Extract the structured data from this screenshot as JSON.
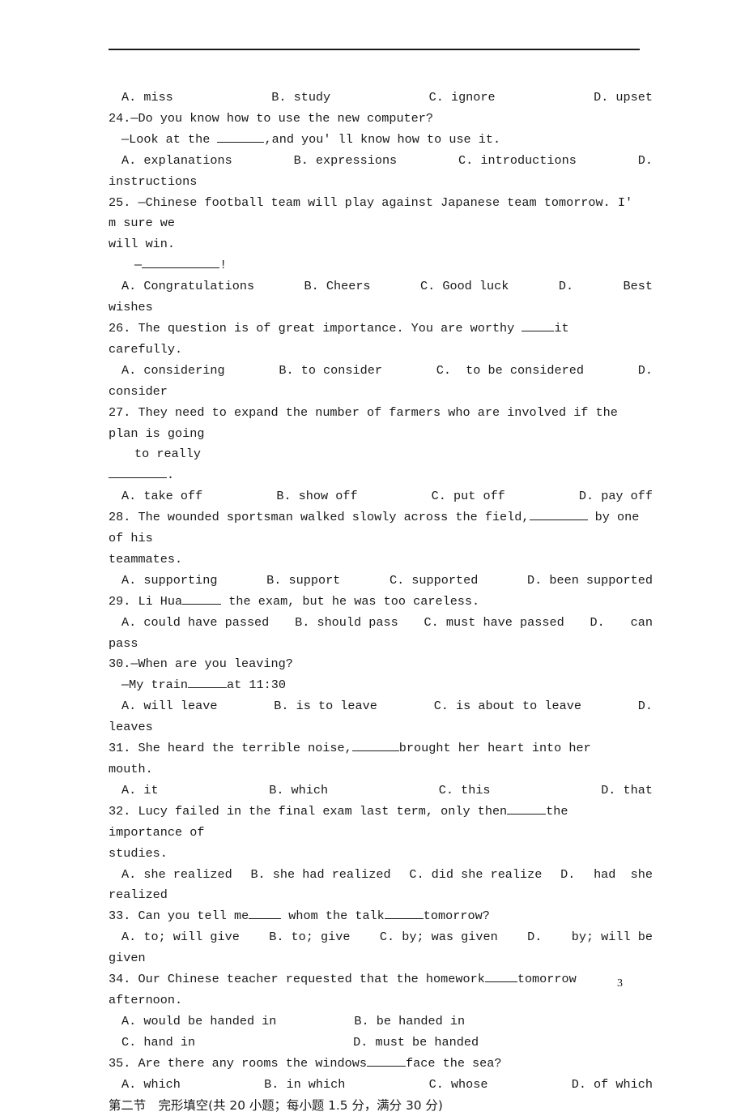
{
  "page": {
    "number": "3",
    "background": "#ffffff",
    "text_color": "#1a1a1a"
  },
  "header": {
    "rule": true
  },
  "lines": {
    "q23_options": {
      "a": "A. miss",
      "b": "B. study",
      "c": "C. ignore",
      "d": "D. upset"
    },
    "q24": {
      "number": "24.",
      "stem_q": "—Do you know how to use the new computer?",
      "stem_a_pre": "—Look at the ",
      "stem_a_post": ",and you' ll know how to use it.",
      "opt_a": "A. explanations",
      "opt_b": "B. expressions",
      "opt_c": "C. introductions",
      "opt_d": "D.",
      "opt_d_cont": "instructions"
    },
    "q25": {
      "number": "25.",
      "stem_line1": "—Chinese football team will play against Japanese team tomorrow. I' m sure we",
      "stem_line2": "will win.",
      "reply_pre": "—",
      "reply_post": "!",
      "opt_a": "A. Congratulations",
      "opt_b": "B. Cheers",
      "opt_c": "C. Good luck",
      "opt_d": "D.",
      "opt_d_tail": "Best",
      "opt_d_cont": "wishes"
    },
    "q26": {
      "number": "26.",
      "stem_pre": "The question is of great importance. You are worthy ",
      "stem_post": "it carefully.",
      "opt_a": "A. considering",
      "opt_b": "B. to consider",
      "opt_c": "C.  to be considered",
      "opt_d": "D.",
      "opt_d_cont": "consider"
    },
    "q27": {
      "number": "27.",
      "stem_line1": "They need to expand the number of farmers who are involved if the plan is going",
      "stem_line2": "to really",
      "stem_line3_post": ".",
      "opt_a": "A. take off",
      "opt_b": "B. show off",
      "opt_c": "C. put off",
      "opt_d": "D. pay off"
    },
    "q28": {
      "number": "28.",
      "stem_pre": "The wounded sportsman walked slowly across the field,",
      "stem_post": " by one of his",
      "stem_line2": "teammates.",
      "opt_a": "A. supporting",
      "opt_b": "B. support",
      "opt_c": "C. supported",
      "opt_d": "D. been supported"
    },
    "q29": {
      "number": "29.",
      "stem_pre": "Li Hua",
      "stem_post": " the exam, but he was too careless.",
      "opt_a": "A. could have passed",
      "opt_b": "B. should pass",
      "opt_c": "C. must have passed",
      "opt_d": "D.",
      "opt_d_tail": "can",
      "opt_d_cont": "pass"
    },
    "q30": {
      "number": "30.",
      "stem_q": "—When are you leaving?",
      "stem_a_pre": "—My train",
      "stem_a_post": "at 11:30",
      "opt_a": "A. will leave",
      "opt_b": "B. is to leave",
      "opt_c": "C. is about to leave",
      "opt_d": "D.",
      "opt_d_cont": "leaves"
    },
    "q31": {
      "number": "31.",
      "stem_pre": "She heard the terrible noise,",
      "stem_post": "brought her heart into her mouth.",
      "opt_a": "A. it",
      "opt_b": "B. which",
      "opt_c": "C. this",
      "opt_d": "D. that"
    },
    "q32": {
      "number": "32.",
      "stem_pre": "Lucy failed in the final exam last term, only then",
      "stem_post": "the importance of",
      "stem_line2": "studies.",
      "opt_a": "A. she realized",
      "opt_b": "B. she had realized",
      "opt_c": "C. did she realize",
      "opt_d": "D.",
      "opt_d_tail": "had  she",
      "opt_d_cont": "realized"
    },
    "q33": {
      "number": "33.",
      "stem_pre": "Can you tell me",
      "stem_mid": " whom the talk",
      "stem_post": "tomorrow?",
      "opt_a": "A. to; will give",
      "opt_b": "B. to; give",
      "opt_c": "C. by; was given",
      "opt_d": "D.",
      "opt_d_tail": "by; will be",
      "opt_d_cont": "given"
    },
    "q34": {
      "number": "34.",
      "stem_pre": "Our Chinese teacher requested that the homework",
      "stem_post": "tomorrow afternoon.",
      "opt_a": "A. would be handed in",
      "opt_b": "B. be handed in",
      "opt_c": "C. hand in",
      "opt_d": "D. must be handed"
    },
    "q35": {
      "number": "35.",
      "stem_pre": "Are there any rooms the windows",
      "stem_post": "face the sea?",
      "opt_a": "A. which",
      "opt_b": "B. in which",
      "opt_c": "C. whose",
      "opt_d": "D. of which"
    },
    "section2": {
      "title": "第二节　完形填空(共 20 小题；每小题 1.5 分，满分 30 分)"
    }
  }
}
